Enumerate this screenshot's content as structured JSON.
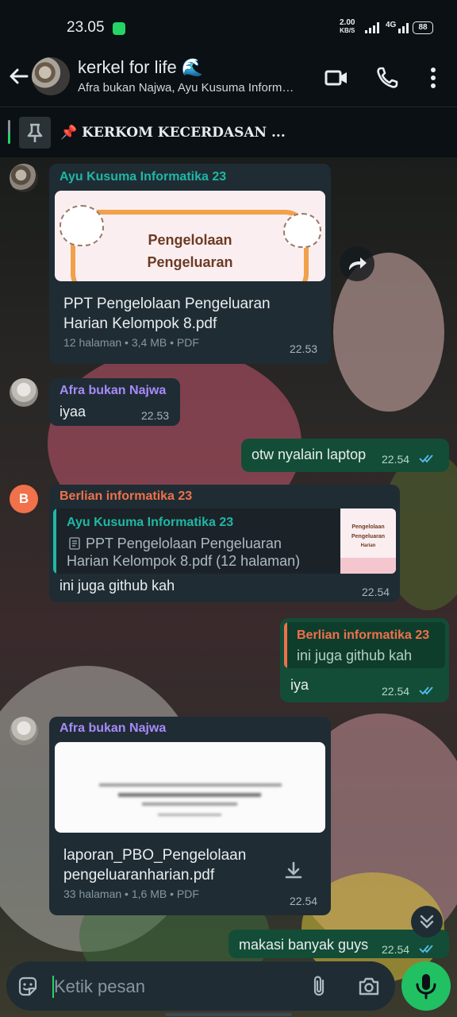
{
  "status": {
    "time": "23.05",
    "net_speed_value": "2.00",
    "net_speed_unit": "KB/S",
    "network": "4G",
    "battery": "88"
  },
  "header": {
    "title": "kerkel for life 🌊",
    "subtitle": "Afra bukan Najwa, Ayu Kusuma Inform…"
  },
  "pinned": {
    "text": "📌 KERKOM KECERDASAN  ..."
  },
  "messages": {
    "m1": {
      "sender": "Ayu Kusuma Informatika 23",
      "sender_color": "#1fb7a6",
      "thumb_line1": "Pengelolaan",
      "thumb_line2": "Pengeluaran",
      "doc_title": "PPT Pengelolaan Pengeluaran Harian Kelompok 8.pdf",
      "doc_meta": "12 halaman • 3,4 MB • PDF",
      "time": "22.53"
    },
    "m2": {
      "sender": "Afra bukan Najwa",
      "sender_color": "#a78bfa",
      "text": "iyaa",
      "time": "22.53"
    },
    "m3": {
      "text": "otw nyalain laptop",
      "time": "22.54"
    },
    "m4": {
      "avatar_letter": "B",
      "sender": "Berlian informatika 23",
      "sender_color": "#f0714a",
      "quote_sender": "Ayu Kusuma Informatika 23",
      "quote_text": "PPT Pengelolaan Pengeluaran Harian Kelompok 8.pdf (12 halaman)",
      "quote_thumb_line1": "Pengelolaan",
      "quote_thumb_line2": "Pengeluaran",
      "quote_thumb_line3": "Harian",
      "text": "ini juga github kah",
      "time": "22.54"
    },
    "m5": {
      "quote_sender": "Berlian informatika 23",
      "quote_text": "ini juga github kah",
      "text": "iya",
      "time": "22.54"
    },
    "m6": {
      "sender": "Afra bukan Najwa",
      "sender_color": "#a78bfa",
      "doc_title": "laporan_PBO_Pengelolaan pengeluaranharian.pdf",
      "doc_meta": "33 halaman • 1,6 MB • PDF",
      "time": "22.54"
    },
    "m7": {
      "text": "makasi banyak guys",
      "time": "22.54"
    }
  },
  "composer": {
    "placeholder": "Ketik pesan"
  },
  "colors": {
    "accent": "#21c063",
    "incoming_bubble": "#1f2c34",
    "outgoing_bubble": "#134d37",
    "read_ticks": "#53bdeb"
  }
}
